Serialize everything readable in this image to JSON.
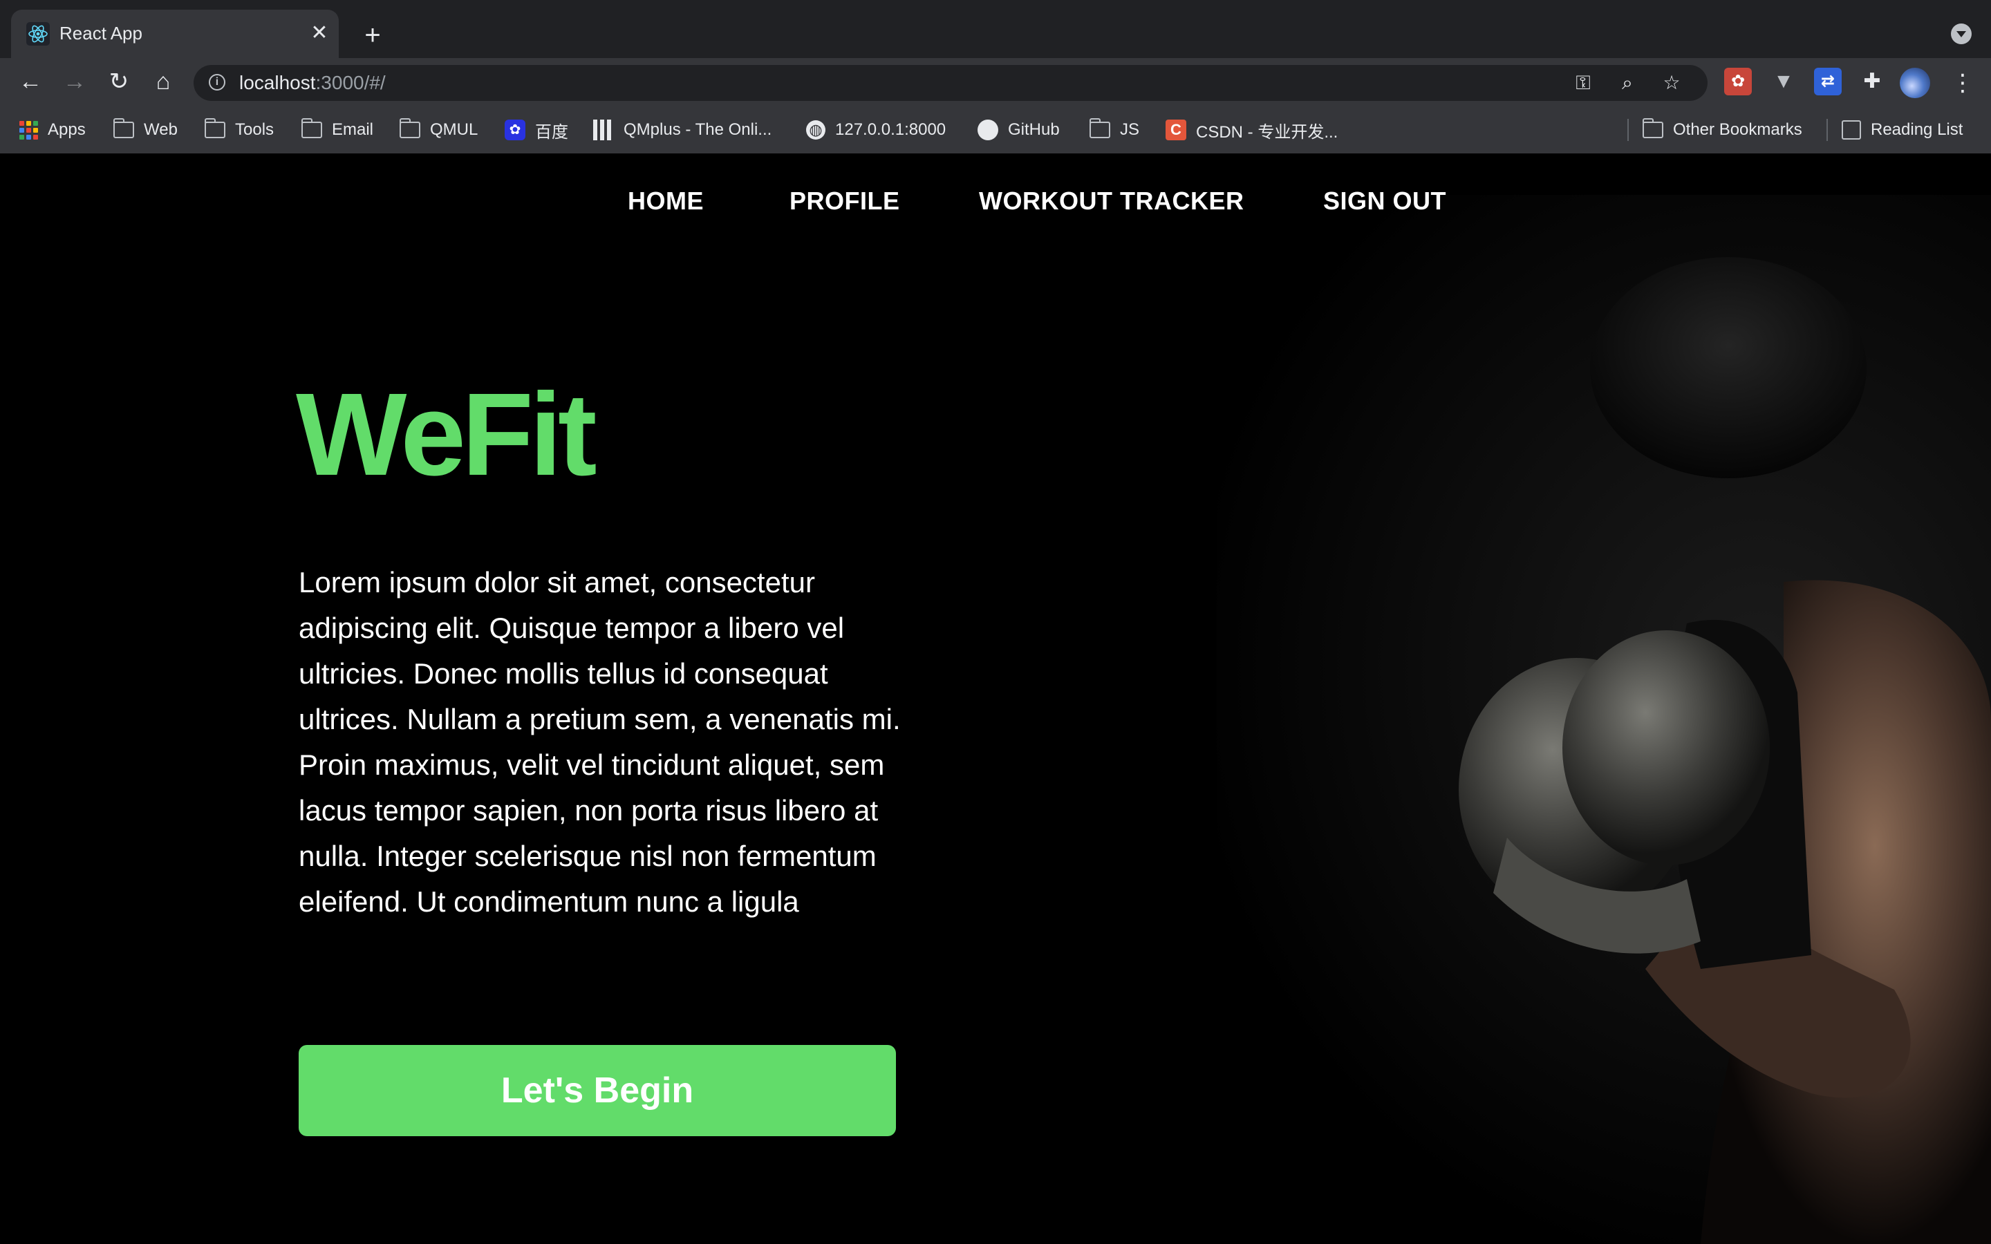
{
  "browser": {
    "tab_title": "React App",
    "url_host": "localhost",
    "url_rest": ":3000/#/",
    "bookmarks": [
      {
        "label": "Apps",
        "icon": "apps-grid-icon"
      },
      {
        "label": "Web",
        "icon": "folder-icon"
      },
      {
        "label": "Tools",
        "icon": "folder-icon"
      },
      {
        "label": "Email",
        "icon": "folder-icon"
      },
      {
        "label": "QMUL",
        "icon": "folder-icon"
      },
      {
        "label": "百度",
        "icon": "baidu-icon"
      },
      {
        "label": "QMplus - The Onli...",
        "icon": "qmplus-icon"
      },
      {
        "label": "127.0.0.1:8000",
        "icon": "globe-icon"
      },
      {
        "label": "GitHub",
        "icon": "github-icon"
      },
      {
        "label": "JS",
        "icon": "folder-icon"
      },
      {
        "label": "CSDN - 专业开发...",
        "icon": "csdn-icon"
      }
    ],
    "other_bookmarks": "Other Bookmarks",
    "reading_list": "Reading List"
  },
  "nav": {
    "home": "HOME",
    "profile": "PROFILE",
    "workout_tracker": "WORKOUT TRACKER",
    "sign_out": "SIGN OUT"
  },
  "hero": {
    "brand": "WeFit",
    "description": "Lorem ipsum dolor sit amet, consectetur adipiscing elit. Quisque tempor a libero vel ultricies. Donec mollis tellus id consequat ultrices. Nullam a pretium sem, a venenatis mi. Proin maximus, velit vel tincidunt aliquet, sem lacus tempor sapien, non porta risus libero at nulla. Integer scelerisque nisl non fermentum eleifend. Ut condimentum nunc a ligula",
    "cta": "Let's Begin",
    "image": "boxer-with-gloves-photo"
  },
  "colors": {
    "accent": "#62dc6a",
    "page_bg": "#000000",
    "chrome_bg": "#35363a"
  }
}
